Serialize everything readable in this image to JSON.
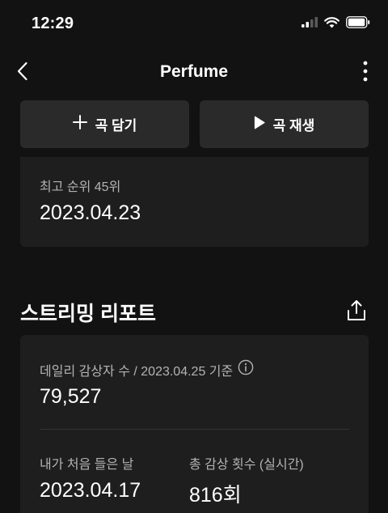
{
  "status_bar": {
    "time": "12:29",
    "icons": [
      "signal-icon",
      "wifi-icon",
      "battery-icon"
    ]
  },
  "nav": {
    "title": "Perfume",
    "back_icon": "chevron-left-icon",
    "more_icon": "more-vertical-icon"
  },
  "actions": {
    "add_label": "곡 담기",
    "add_icon": "plus-icon",
    "play_label": "곡 재생",
    "play_icon": "play-icon"
  },
  "peak": {
    "label": "최고 순위 45위",
    "date": "2023.04.23"
  },
  "streaming_report": {
    "title": "스트리밍 리포트",
    "share_icon": "share-icon",
    "daily_listeners_label": "데일리 감상자 수 / 2023.04.25 기준",
    "info_icon": "info-icon",
    "daily_listeners_value": "79,527",
    "first_listen_label": "내가 처음 들은 날",
    "first_listen_value": "2023.04.17",
    "total_plays_label": "총 감상 횟수 (실시간)",
    "total_plays_value": "816회"
  },
  "colors": {
    "background": "#121212",
    "card": "#1e1e1e",
    "button": "#2a2a2a",
    "secondary_text": "#b3b3b3"
  }
}
